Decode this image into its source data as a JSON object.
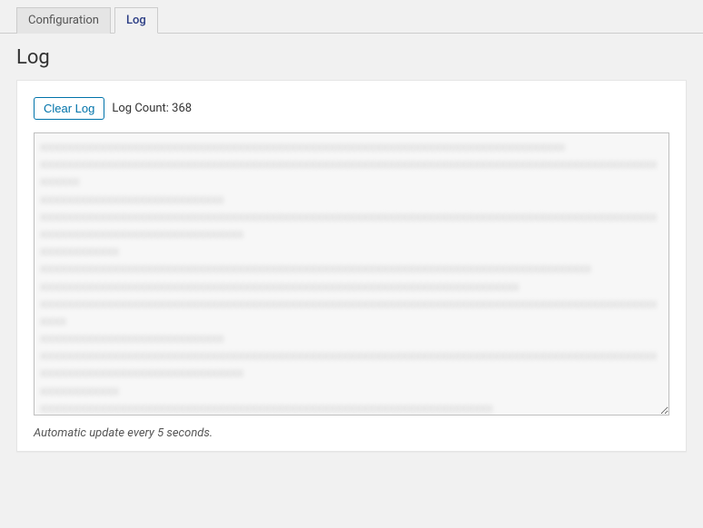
{
  "tabs": {
    "configuration_label": "Configuration",
    "log_label": "Log"
  },
  "page_title": "Log",
  "controls": {
    "clear_button_label": "Clear Log",
    "log_count_prefix": "Log Count: ",
    "log_count_value": "368"
  },
  "log_content": "xxxxxxxxxxxxxxxxxxxxxxxxxxxxxxxxxxxxxxxxxxxxxxxxxxxxxxxxxxxxxxxxxxxxxxxxxxxxxxxx\nxxxxxxxxxxxxxxxxxxxxxxxxxxxxxxxxxxxxxxxxxxxxxxxxxxxxxxxxxxxxxxxxxxxxxxxxxxxxxxxxxxxxxxxxxxxxxxxxxxxx\nxxxxxxxxxxxxxxxxxxxxxxxxxxxx\nxxxxxxxxxxxxxxxxxxxxxxxxxxxxxxxxxxxxxxxxxxxxxxxxxxxxxxxxxxxxxxxxxxxxxxxxxxxxxxxxxxxxxxxxxxxxxxxxxxxxxxxxxxxxxxxxxxxxxxxxxxxxx\nxxxxxxxxxxxx\nxxxxxxxxxxxxxxxxxxxxxxxxxxxxxxxxxxxxxxxxxxxxxxxxxxxxxxxxxxxxxxxxxxxxxxxxxxxxxxxxxxxx\nxxxxxxxxxxxxxxxxxxxxxxxxxxxxxxxxxxxxxxxxxxxxxxxxxxxxxxxxxxxxxxxxxxxxxxxxx\nxxxxxxxxxxxxxxxxxxxxxxxxxxxxxxxxxxxxxxxxxxxxxxxxxxxxxxxxxxxxxxxxxxxxxxxxxxxxxxxxxxxxxxxxxxxxxxxxxx\nxxxxxxxxxxxxxxxxxxxxxxxxxxxx\nxxxxxxxxxxxxxxxxxxxxxxxxxxxxxxxxxxxxxxxxxxxxxxxxxxxxxxxxxxxxxxxxxxxxxxxxxxxxxxxxxxxxxxxxxxxxxxxxxxxxxxxxxxxxxxxxxxxxxxxxxxxxx\nxxxxxxxxxxxx\nxxxxxxxxxxxxxxxxxxxxxxxxxxxxxxxxxxxxxxxxxxxxxxxxxxxxxxxxxxxxxxxxxxxxx\nxxxxxxxxxxxxxxxxxxxxxxxxxxxxxxxxxxxxxxxxxxxxxxxxxxxxxxxxxxxxxxxxxxxxxxxxxxxxxx\nxxxxxxxxxxxxxxxxxxxxxxxxxxxxxxxxxxxxxxxxxxxxxxxxxxxxxxxxxxxxxxxxxxxxxxxxxxxxxx\nxxxxxxxxxxxxxxxxxxxxxxxxxxxxxxxxxxxxxxxxxxxxxxxxxxxxxxxxxxxxxxxxxxxxxxxxxxxxxxxxxxxxxxxxxxxxxxxxxxxx\nxxxxxxxxxxxxxxxxxxxxxxxxxxxxxxxxxxxxxxxxxxxxxxxxxxxxxxxxxxxxxxxxxxxxxxxxxxxxxxxxxxxxxxxxxxxxxxxxxxxxxxxx\nxxxxxxxxxxxxxxxxxxxxxxxxxxxxxxxxxxxxxxxxxxxxxxxxxxxxxxxxxxxxxxxxxxxxxxxxxxxxxxxxxxxxxxxxxxxxxxxxxxxxxxxxxxxxxxxx\nxxxxxxxxxxxxxxxxxxxxxxxxxxxxxxxxxxxxxxxxxxxxxxxxxxxxxxxxxxxxxxxxxxxxxxxxxxxxxxxxxxxxxxxxxxxx",
  "footer": {
    "update_note": "Automatic update every 5 seconds."
  }
}
